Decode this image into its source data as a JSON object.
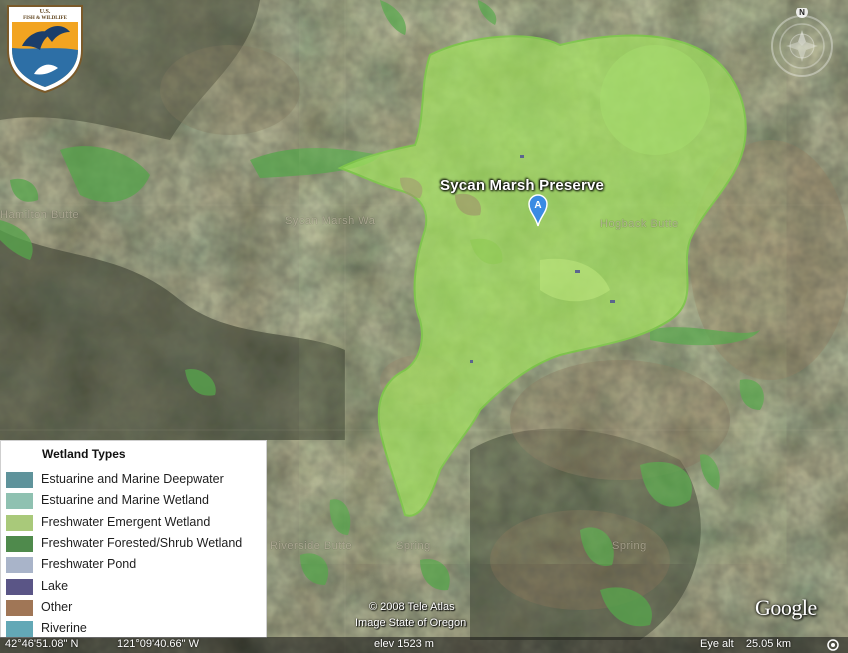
{
  "map": {
    "place_label": "Sycan Marsh Preserve",
    "placemark_letter": "A",
    "faint_labels": [
      "Hamilton Butte",
      "Sycan Marsh Wa",
      "Spring",
      "Spring",
      "Hogback Butte",
      "Riverside Butte"
    ]
  },
  "logo": {
    "name": "fws-logo",
    "arc_text": "U.S. FISH & WILDLIFE SERVICE"
  },
  "compass": {
    "north_label": "N"
  },
  "legend": {
    "title": "Wetland Types",
    "items": [
      {
        "label": "Estuarine and Marine Deepwater",
        "color": "#5f939b"
      },
      {
        "label": "Estuarine and Marine Wetland",
        "color": "#8fc1b1"
      },
      {
        "label": "Freshwater Emergent Wetland",
        "color": "#a9c97a"
      },
      {
        "label": "Freshwater Forested/Shrub Wetland",
        "color": "#4f8a4c"
      },
      {
        "label": "Freshwater Pond",
        "color": "#a9b4c9"
      },
      {
        "label": "Lake",
        "color": "#5a5586"
      },
      {
        "label": "Other",
        "color": "#a07656"
      },
      {
        "label": "Riverine",
        "color": "#63a8b6"
      }
    ]
  },
  "status": {
    "latitude": "42°46'51.08\" N",
    "longitude": "121°09'40.66\" W",
    "elevation": "elev 1523 m",
    "eye_alt": "Eye alt    25.05 km"
  },
  "copyright": {
    "line1": "© 2008 Tele Atlas",
    "line2": "Image State of Oregon"
  },
  "brand": {
    "google": "Google"
  }
}
